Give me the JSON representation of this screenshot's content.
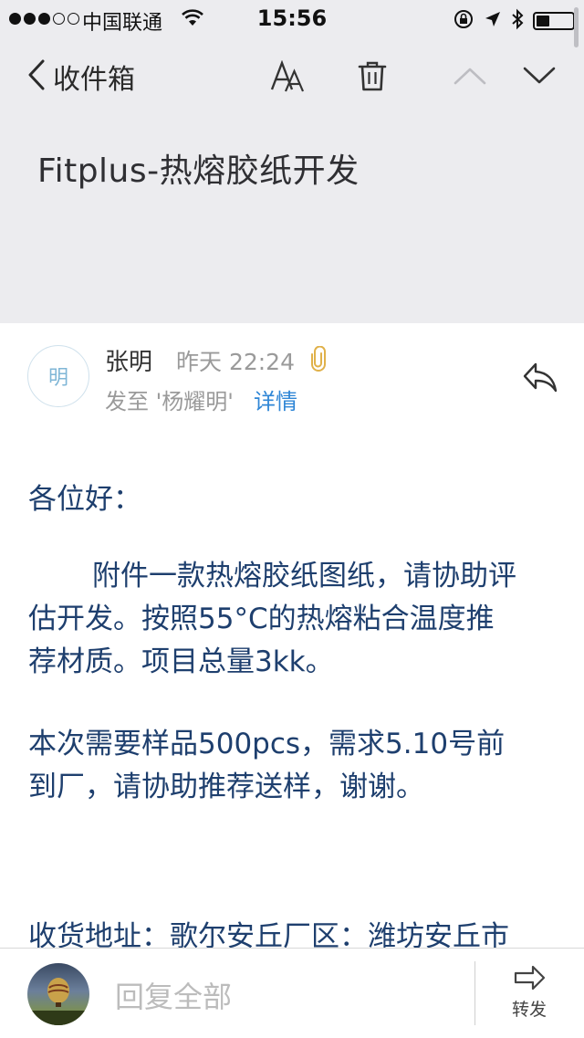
{
  "status_bar": {
    "carrier": "中国联通",
    "time": "15:56",
    "signal_full": 3,
    "signal_empty": 2,
    "battery_level": 0.38
  },
  "nav": {
    "back_label": "收件箱",
    "icons": [
      "font-size-icon",
      "trash-icon",
      "chevron-up-icon",
      "chevron-down-icon"
    ]
  },
  "email": {
    "subject": "Fitplus-热熔胶纸开发",
    "sender": {
      "avatar_char": "明",
      "name": "张明",
      "date": "昨天 22:24",
      "sent_to": "发至 '杨耀明'",
      "details_link": "详情"
    },
    "body": {
      "greeting": "各位好：",
      "para1_line1": "附件一款热熔胶纸图纸，请协助评",
      "para1_line2": "估开发。按照55°C的热熔粘合温度推",
      "para1_line3": "荐材质。项目总量3kk。",
      "para2_line1": "本次需要样品500pcs，需求5.10号前",
      "para2_line2": "到厂，请协助推荐送样，谢谢。",
      "para3_line1": "收货地址：歌尔安丘厂区：潍坊安丘市"
    }
  },
  "bottom_bar": {
    "reply_all_placeholder": "回复全部",
    "forward_label": "转发"
  },
  "colors": {
    "header_bg": "#ececef",
    "body_text": "#1e3f6e",
    "link": "#2f86d6",
    "attachment": "#e0b14a"
  }
}
